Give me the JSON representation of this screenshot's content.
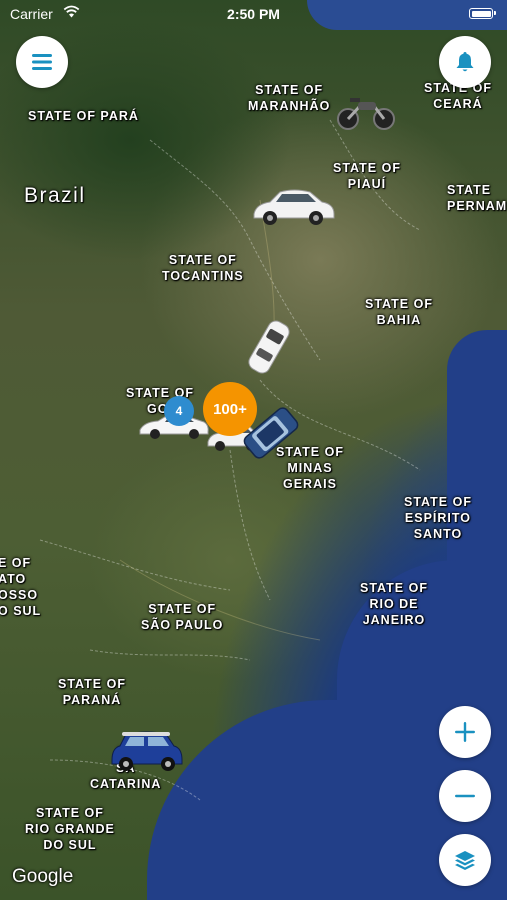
{
  "status_bar": {
    "carrier": "Carrier",
    "time": "2:50 PM"
  },
  "map": {
    "country_label": "Brazil",
    "state_labels": [
      {
        "id": "para",
        "text": "STATE OF PARÁ"
      },
      {
        "id": "maranhao",
        "text": "STATE OF\nMARANHÃO"
      },
      {
        "id": "ceara",
        "text": "STATE OF\nCEARÁ"
      },
      {
        "id": "piaui",
        "text": "STATE OF\nPIAUÍ"
      },
      {
        "id": "pernambuco",
        "text": "STATE\nPERNAM"
      },
      {
        "id": "tocantins",
        "text": "STATE OF\nTOCANTINS"
      },
      {
        "id": "bahia",
        "text": "STATE OF\nBAHIA"
      },
      {
        "id": "goias",
        "text": "STATE OF\nGOI"
      },
      {
        "id": "minas",
        "text": "STATE OF\nMINAS\nGERAIS"
      },
      {
        "id": "espirito",
        "text": "STATE OF\nESPÍRITO\nSANTO"
      },
      {
        "id": "mato",
        "text": "E OF\nATO\nOSSO\nO SUL"
      },
      {
        "id": "saopaulo",
        "text": "STATE OF\nSÃO PAULO"
      },
      {
        "id": "rio",
        "text": "STATE OF\nRIO DE\nJANEIRO"
      },
      {
        "id": "parana",
        "text": "STATE OF\nPARANÁ"
      },
      {
        "id": "santacatarina",
        "text": "ST\nSA\nCATARINA"
      },
      {
        "id": "riogrande",
        "text": "STATE OF\nRIO GRANDE\nDO SUL"
      }
    ],
    "attribution": "Google"
  },
  "clusters": [
    {
      "id": "orange",
      "count": "100+",
      "color": "#f59400"
    },
    {
      "id": "blue",
      "count": "4",
      "color": "#2e8ccf"
    }
  ],
  "vehicles": [
    {
      "id": "motorcycle",
      "kind": "motorcycle"
    },
    {
      "id": "car-piaui",
      "kind": "white-sedan"
    },
    {
      "id": "car-bahia",
      "kind": "white-sedan"
    },
    {
      "id": "car-goias",
      "kind": "white-sports-car"
    },
    {
      "id": "car-center",
      "kind": "white-sedan"
    },
    {
      "id": "car-blue",
      "kind": "blue-sedan"
    },
    {
      "id": "car-mini",
      "kind": "blue-mini"
    }
  ],
  "controls": {
    "menu_icon": "hamburger-icon",
    "notification_icon": "bell-icon",
    "zoom_in_icon": "plus-icon",
    "zoom_out_icon": "minus-icon",
    "layers_icon": "layers-icon",
    "accent_color": "#1a91c0"
  }
}
